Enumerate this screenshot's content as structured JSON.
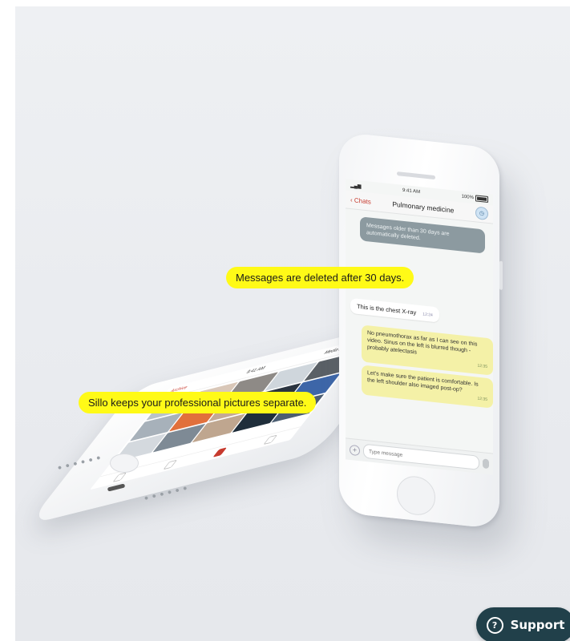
{
  "callouts": {
    "deleted": "Messages are deleted after 30 days.",
    "separate": "Sillo keeps your professional pictures separate."
  },
  "upright_phone": {
    "status_time": "9:41 AM",
    "battery": "100%",
    "back_label": "Chats",
    "chat_title": "Pulmonary medicine",
    "system_notice": "Messages older than 30 days are automatically deleted.",
    "messages": [
      {
        "text": "This is the chest X-ray",
        "time": "12:24"
      },
      {
        "text": "No pneumothorax as far as I can see on this video. Sinus on the left is blurred though - probably atelectasis",
        "time": "12:35"
      },
      {
        "text": "Let's make sure the patient is comfortable. Is the left shoulder also imaged post-op?",
        "time": "12:35"
      }
    ],
    "input_placeholder": "Type message"
  },
  "flat_phone": {
    "back_label": "Archive",
    "time": "9:41 AM",
    "title": "Media from chats",
    "tiles": [
      "#b9c2c8",
      "#d9c7b8",
      "#8e8a86",
      "#cfd6dc",
      "#5a6066",
      "#a7b1ba",
      "#e1703c",
      "#c4a996",
      "#2a3440",
      "#3d66a8",
      "#d4d9de",
      "#7e8a95",
      "#bfa68f",
      "#1f2e3b",
      "#4c5e72"
    ]
  },
  "support": {
    "label": "Support",
    "icon": "?"
  },
  "colors": {
    "callout": "#fffa17",
    "support_bg": "#21404a",
    "accent_red": "#c73a2e",
    "bubble_out": "#f4f1a7"
  }
}
